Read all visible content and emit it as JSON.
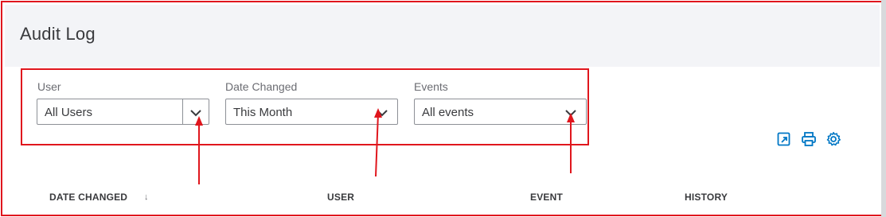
{
  "page": {
    "title": "Audit Log"
  },
  "filters": {
    "user": {
      "label": "User",
      "value": "All Users"
    },
    "date_changed": {
      "label": "Date Changed",
      "value": "This Month"
    },
    "events": {
      "label": "Events",
      "value": "All events"
    }
  },
  "toolbar": {
    "icons": [
      "export-icon",
      "print-icon",
      "settings-gear-icon"
    ]
  },
  "table": {
    "columns": [
      "DATE CHANGED",
      "USER",
      "EVENT",
      "HISTORY"
    ],
    "sort_indicator": "↓"
  },
  "annotations": {
    "highlight_color": "#e0161d"
  },
  "colors": {
    "accent": "#0077c5",
    "header_bg": "#f3f4f7"
  }
}
